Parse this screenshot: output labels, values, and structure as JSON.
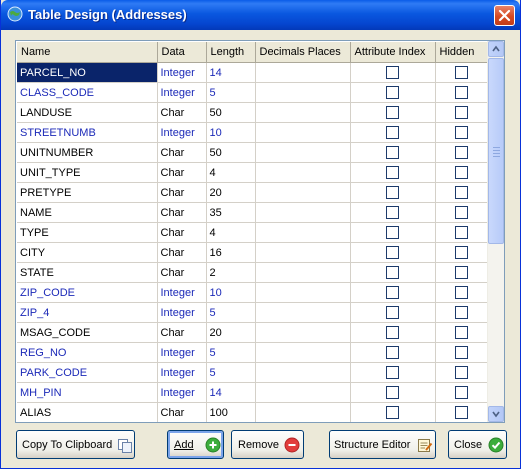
{
  "window": {
    "title": "Table Design (Addresses)"
  },
  "columns": [
    "Name",
    "Data",
    "Length",
    "Decimals Places",
    "Attribute Index",
    "Hidden"
  ],
  "rows": [
    {
      "name": "PARCEL_NO",
      "type": "Integer",
      "length": "14",
      "integer": true,
      "selected": true
    },
    {
      "name": "CLASS_CODE",
      "type": "Integer",
      "length": "5",
      "integer": true
    },
    {
      "name": "LANDUSE",
      "type": "Char",
      "length": "50"
    },
    {
      "name": "STREETNUMB",
      "type": "Integer",
      "length": "10",
      "integer": true
    },
    {
      "name": "UNITNUMBER",
      "type": "Char",
      "length": "50"
    },
    {
      "name": "UNIT_TYPE",
      "type": "Char",
      "length": "4"
    },
    {
      "name": "PRETYPE",
      "type": "Char",
      "length": "20"
    },
    {
      "name": "NAME",
      "type": "Char",
      "length": "35"
    },
    {
      "name": "TYPE",
      "type": "Char",
      "length": "4"
    },
    {
      "name": "CITY",
      "type": "Char",
      "length": "16"
    },
    {
      "name": "STATE",
      "type": "Char",
      "length": "2"
    },
    {
      "name": "ZIP_CODE",
      "type": "Integer",
      "length": "10",
      "integer": true
    },
    {
      "name": "ZIP_4",
      "type": "Integer",
      "length": "5",
      "integer": true
    },
    {
      "name": "MSAG_CODE",
      "type": "Char",
      "length": "20"
    },
    {
      "name": "REG_NO",
      "type": "Integer",
      "length": "5",
      "integer": true
    },
    {
      "name": "PARK_CODE",
      "type": "Integer",
      "length": "5",
      "integer": true
    },
    {
      "name": "MH_PIN",
      "type": "Integer",
      "length": "14",
      "integer": true
    },
    {
      "name": "ALIAS",
      "type": "Char",
      "length": "100"
    }
  ],
  "buttons": {
    "copy": "Copy To Clipboard",
    "add": "Add",
    "remove": "Remove",
    "structure": "Structure Editor",
    "close": "Close"
  },
  "colors": {
    "titlebar": "#0a58e0",
    "integer_text": "#1c2ab8",
    "selection": "#0a246a"
  }
}
